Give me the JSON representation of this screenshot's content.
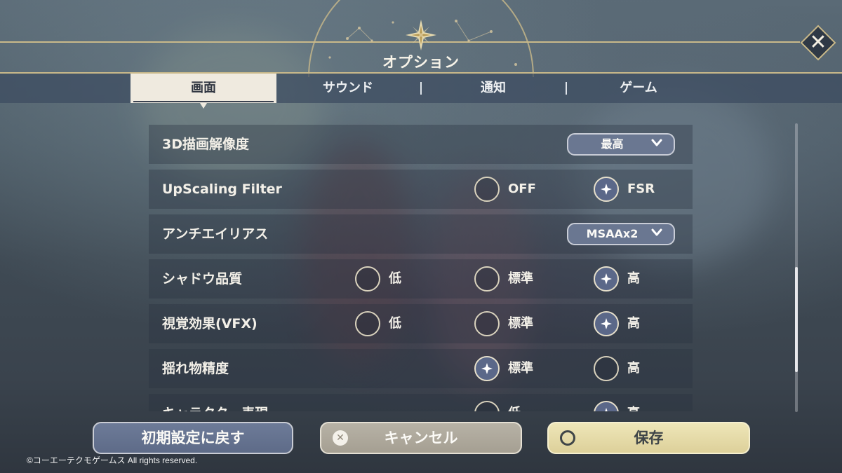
{
  "header": {
    "title": "オプション",
    "close_icon": "close-icon"
  },
  "tabs": [
    {
      "label": "画面",
      "active": true
    },
    {
      "label": "サウンド",
      "active": false
    },
    {
      "label": "通知",
      "active": false
    },
    {
      "label": "ゲーム",
      "active": false
    }
  ],
  "settings": {
    "resolution": {
      "label": "3D描画解像度",
      "value": "最高"
    },
    "upscaling": {
      "label": "UpScaling Filter",
      "off": "OFF",
      "fsr": "FSR",
      "selected": "FSR"
    },
    "antialias": {
      "label": "アンチエイリアス",
      "value": "MSAAx2"
    },
    "shadow": {
      "label": "シャドウ品質",
      "low": "低",
      "standard": "標準",
      "high": "高",
      "selected": "高"
    },
    "vfx": {
      "label": "視覚効果(VFX)",
      "low": "低",
      "standard": "標準",
      "high": "高",
      "selected": "高"
    },
    "sway": {
      "label": "揺れ物精度",
      "standard": "標準",
      "high": "高",
      "selected": "標準"
    },
    "character": {
      "label": "キャラクター表現",
      "low": "低",
      "high": "高",
      "selected": "高"
    }
  },
  "scroll": {
    "position": 0.5
  },
  "footer": {
    "reset_label": "初期設定に戻す",
    "cancel_label": "キャンセル",
    "save_label": "保存",
    "copyright": "©コーエーテクモゲームス All rights reserved."
  },
  "colors": {
    "accent_gold": "#c9b98a",
    "tab_active_bg": "#efeadf",
    "radio_on": "#5b6889"
  }
}
